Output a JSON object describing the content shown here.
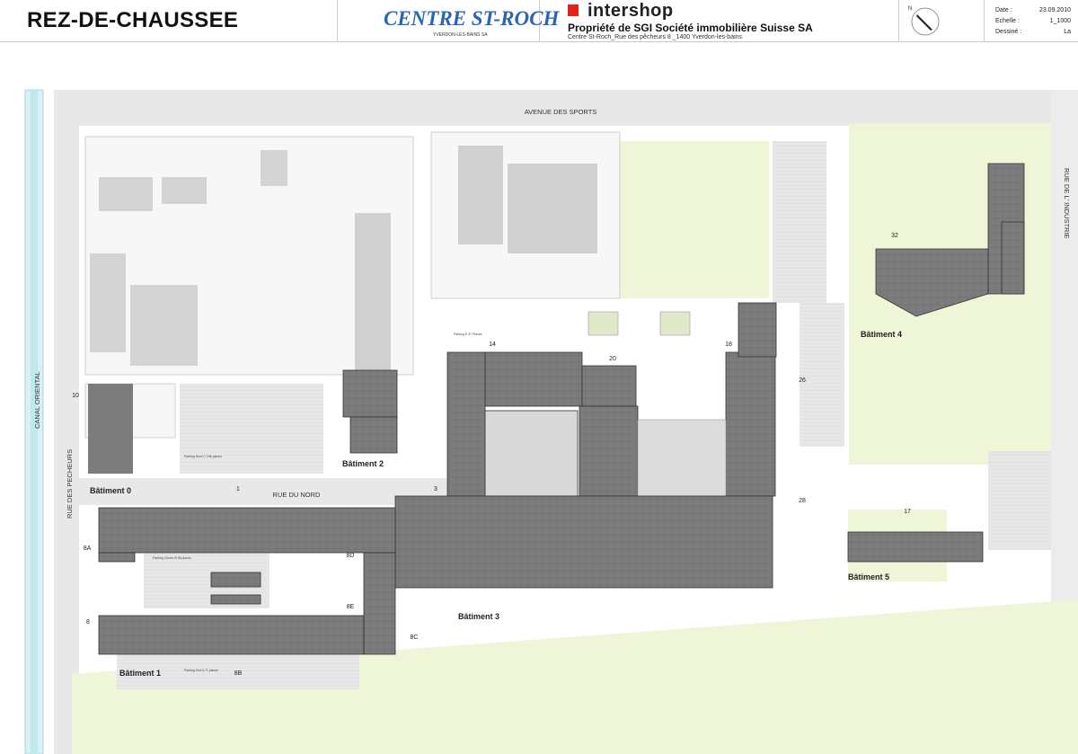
{
  "header": {
    "title": "REZ-DE-CHAUSSEE",
    "logo_centre": "CENTRE ST-ROCH",
    "logo_centre_sub": "YVERDON-LES-BAINS SA",
    "logo_company": "intershop",
    "owner": "Propriété de SGI Société immobilière Suisse SA",
    "address": "Centre St-Roch_Rue des pêcheurs 8 _1400 Yverdon-les-bains",
    "north": "N",
    "meta": [
      {
        "label": "Date :",
        "value": "23.09.2010"
      },
      {
        "label": "Echelle :",
        "value": "1_1000"
      },
      {
        "label": "Dessiné :",
        "value": "La"
      }
    ]
  },
  "map": {
    "streets": {
      "avenue": "AVENUE DES SPORTS",
      "industrie": "RUE DE L' INDUSTRIE",
      "canal": "CANAL ORIENTAL",
      "pecheurs": "RUE DES PECHEURS",
      "nord": "RUE DU NORD"
    },
    "buildings": {
      "b0": "Bâtiment 0",
      "b1": "Bâtiment 1",
      "b2": "Bâtiment 2",
      "b3": "Bâtiment 3",
      "b4": "Bâtiment 4",
      "b5": "Bâtiment 5"
    },
    "entrances": {
      "e1": "1",
      "e3": "3",
      "e8": "8",
      "e8a": "8A",
      "e8b": "8B",
      "e8c": "8C",
      "e8d": "8D",
      "e8e": "8E",
      "e10": "10",
      "e14": "14",
      "e17": "17",
      "e18": "18",
      "e20": "20",
      "e26": "26",
      "e28": "28",
      "e32": "32"
    },
    "parkings": {
      "p_nord": "Parking Nord C 196 places",
      "p_centre": "Parking Centre B 56 places",
      "p_sud": "Parking Sud A 71 places",
      "p_e": "Parking E 37 Places"
    }
  }
}
